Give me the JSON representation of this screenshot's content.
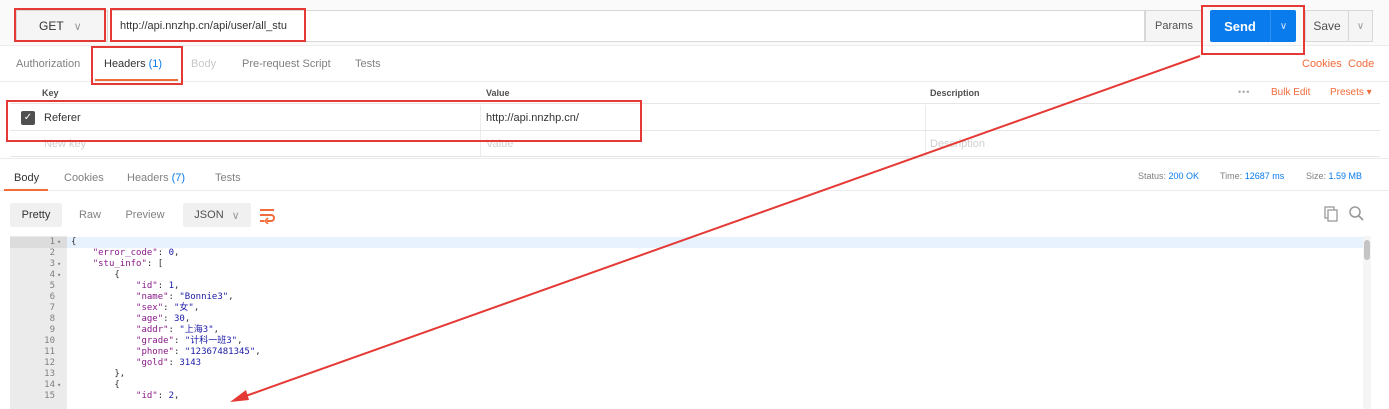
{
  "request": {
    "method": "GET",
    "url": "http://api.nnzhp.cn/api/user/all_stu",
    "params_label": "Params",
    "send_label": "Send",
    "save_label": "Save"
  },
  "request_tabs": {
    "authorization": "Authorization",
    "headers": "Headers",
    "headers_count": "(1)",
    "body": "Body",
    "prerequest": "Pre-request Script",
    "tests": "Tests",
    "cookies": "Cookies",
    "code": "Code"
  },
  "headers_table": {
    "col_key": "Key",
    "col_value": "Value",
    "col_description": "Description",
    "dots": "•••",
    "bulk_edit": "Bulk Edit",
    "presets": "Presets ▾",
    "rows": [
      {
        "key": "Referer",
        "value": "http://api.nnzhp.cn/",
        "checked": true
      }
    ],
    "new_key_placeholder": "New key",
    "value_placeholder": "Value",
    "description_placeholder": "Description"
  },
  "response_tabs": {
    "body": "Body",
    "cookies": "Cookies",
    "headers": "Headers",
    "headers_count": "(7)",
    "tests": "Tests"
  },
  "response_status": {
    "status_label": "Status:",
    "status_value": "200 OK",
    "time_label": "Time:",
    "time_value": "12687 ms",
    "size_label": "Size:",
    "size_value": "1.59 MB"
  },
  "format_bar": {
    "pretty": "Pretty",
    "raw": "Raw",
    "preview": "Preview",
    "json": "JSON"
  },
  "code_lines": [
    {
      "n": "1",
      "fold": true,
      "text": "{"
    },
    {
      "n": "2",
      "fold": false,
      "text": "    \"error_code\": 0,"
    },
    {
      "n": "3",
      "fold": true,
      "text": "    \"stu_info\": ["
    },
    {
      "n": "4",
      "fold": true,
      "text": "        {"
    },
    {
      "n": "5",
      "fold": false,
      "text": "            \"id\": 1,"
    },
    {
      "n": "6",
      "fold": false,
      "text": "            \"name\": \"Bonnie3\","
    },
    {
      "n": "7",
      "fold": false,
      "text": "            \"sex\": \"女\","
    },
    {
      "n": "8",
      "fold": false,
      "text": "            \"age\": 30,"
    },
    {
      "n": "9",
      "fold": false,
      "text": "            \"addr\": \"上海3\","
    },
    {
      "n": "10",
      "fold": false,
      "text": "            \"grade\": \"计科一班3\","
    },
    {
      "n": "11",
      "fold": false,
      "text": "            \"phone\": \"12367481345\","
    },
    {
      "n": "12",
      "fold": false,
      "text": "            \"gold\": 3143"
    },
    {
      "n": "13",
      "fold": false,
      "text": "        },"
    },
    {
      "n": "14",
      "fold": true,
      "text": "        {"
    },
    {
      "n": "15",
      "fold": false,
      "text": "            \"id\": 2,"
    }
  ],
  "colors": {
    "accent_orange": "#f26b3a",
    "send_blue": "#097bed",
    "annotation_red": "#e53935"
  }
}
